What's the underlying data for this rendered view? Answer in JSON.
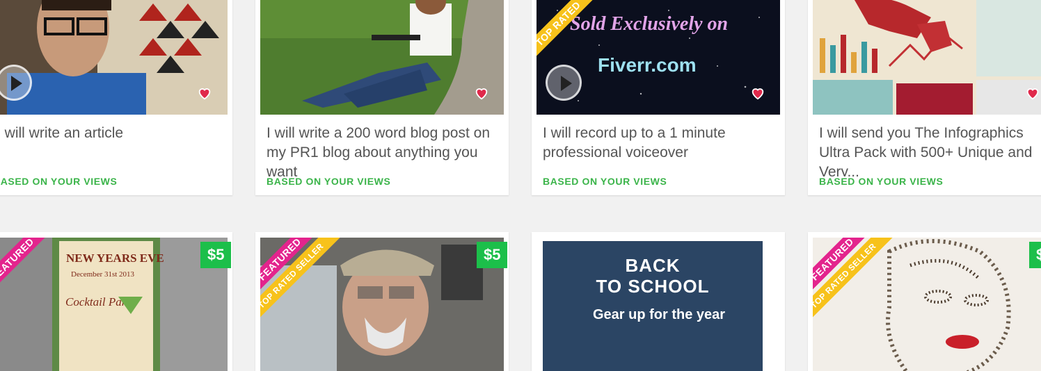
{
  "gigs_row1": [
    {
      "title": "I will write an article",
      "tag": "BASED ON YOUR VIEWS"
    },
    {
      "title": "I will write a 200 word blog post on my PR1 blog about anything you want",
      "tag": "BASED ON YOUR VIEWS"
    },
    {
      "title": "I will record up to a 1 minute professional voiceover",
      "tag": "BASED ON YOUR VIEWS",
      "ribbon_top": "TOP RATED",
      "image_text_1": "Sold Exclusively on",
      "image_text_2": "Fiverr.com"
    },
    {
      "title": "I will send you The Infographics Ultra Pack with 500+ Unique and Very...",
      "tag": "BASED ON YOUR VIEWS"
    }
  ],
  "gigs_row2": [
    {
      "ribbon_featured": "FEATURED",
      "price": "$5",
      "image_text_1": "NEW YEARS EVE",
      "image_text_2": "December 31st 2013",
      "image_text_3": "Cocktail Party"
    },
    {
      "ribbon_featured": "FEATURED",
      "ribbon_top": "TOP RATED SELLER",
      "price": "$5"
    },
    {
      "promo_line1": "BACK",
      "promo_line2": "TO SCHOOL",
      "promo_sub": "Gear up for the year"
    },
    {
      "ribbon_featured": "FEATURED",
      "ribbon_top": "TOP RATED SELLER",
      "price": "$"
    }
  ],
  "colors": {
    "accent_green": "#1cbf4a",
    "tag_green": "#3bb44a",
    "featured_pink": "#e3248d",
    "top_yellow": "#f7c21b",
    "promo_navy": "#2b4564"
  }
}
